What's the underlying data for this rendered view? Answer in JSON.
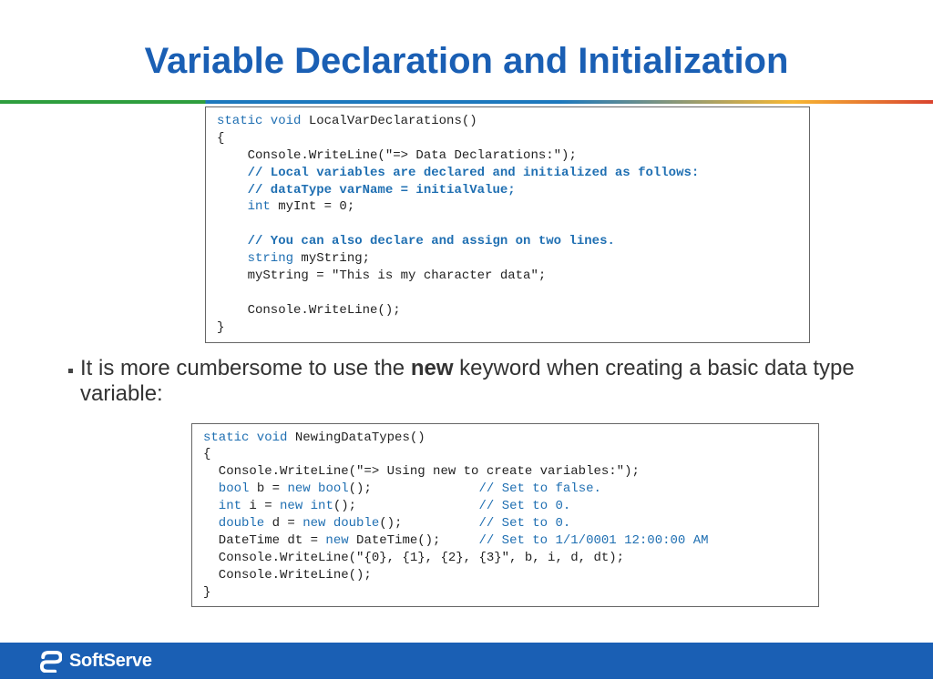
{
  "title": "Variable Declaration and Initialization",
  "code1": {
    "line1a": "static void",
    "line1b": " LocalVarDeclarations()",
    "line2": "{",
    "line3": "    Console.WriteLine(\"=> Data Declarations:\");",
    "line4": "    // Local variables are declared and initialized as follows:",
    "line5": "    // dataType varName = initialValue;",
    "line6a": "    int",
    "line6b": " myInt = 0;",
    "blank": "",
    "line7": "    // You can also declare and assign on two lines.",
    "line8a": "    string",
    "line8b": " myString;",
    "line9": "    myString = \"This is my character data\";",
    "line10": "    Console.WriteLine();",
    "line11": "}"
  },
  "bullet": {
    "pre": "It is more cumbersome to use the ",
    "bold": "new",
    "post": " keyword when creating a basic data type variable:"
  },
  "code2": {
    "line1a": "static void",
    "line1b": " NewingDataTypes()",
    "line2": "{",
    "line3": "  Console.WriteLine(\"=> Using new to create variables:\");",
    "line4a": "  bool",
    "line4b": " b = ",
    "line4c": "new bool",
    "line4d": "();              ",
    "line4e": "// Set to false.",
    "line5a": "  int",
    "line5b": " i = ",
    "line5c": "new int",
    "line5d": "();                ",
    "line5e": "// Set to 0.",
    "line6a": "  double",
    "line6b": " d = ",
    "line6c": "new double",
    "line6d": "();          ",
    "line6e": "// Set to 0.",
    "line7": "  DateTime dt = ",
    "line7c": "new",
    "line7d": " DateTime();     ",
    "line7e": "// Set to 1/1/0001 12:00:00 AM",
    "line8": "  Console.WriteLine(\"{0}, {1}, {2}, {3}\", b, i, d, dt);",
    "line9": "  Console.WriteLine();",
    "line10": "}"
  },
  "footer": {
    "brand": "SoftServe"
  }
}
